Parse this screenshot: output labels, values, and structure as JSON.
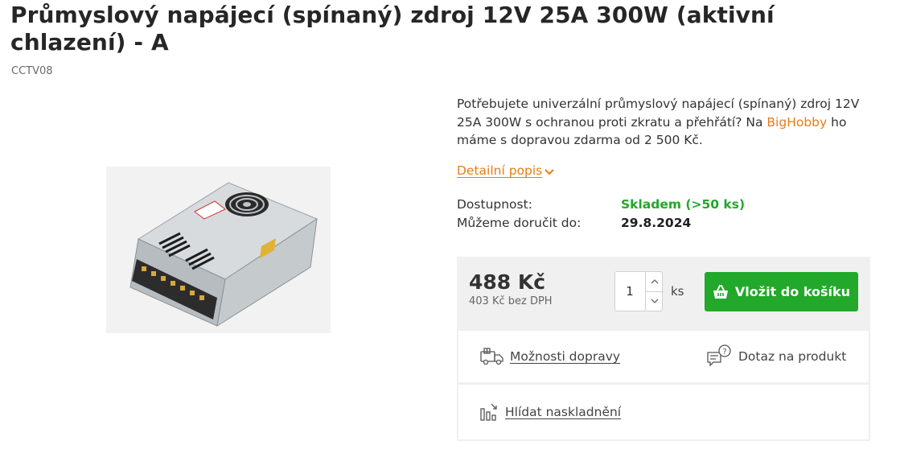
{
  "product": {
    "title": "Průmyslový napájecí (spínaný) zdroj 12V 25A 300W (aktivní chlazení) - A",
    "code": "CCTV08",
    "image_alt": "Průmyslový napájecí zdroj 12V 25A 300W",
    "description_before": "Potřebujete univerzální průmyslový napájecí (spínaný) zdroj 12V 25A 300W s ochranou proti zkratu a přehřátí? Na ",
    "description_link": "BigHobby",
    "description_after": " ho máme s dopravou zdarma od 2 500 Kč.",
    "detail_link": "Detailní popis"
  },
  "availability": {
    "label": "Dostupnost:",
    "value": "Skladem (>50 ks)",
    "delivery_label": "Můžeme doručit do:",
    "delivery_value": "29.8.2024"
  },
  "pricing": {
    "price": "488 Kč",
    "price_without_vat": "403 Kč bez DPH",
    "quantity": "1",
    "unit": "ks",
    "add_to_cart": "Vložit do košíku"
  },
  "actions": {
    "shipping": "Možnosti dopravy",
    "question": "Dotaz na produkt",
    "watch_stock": "Hlídat naskladnění"
  },
  "colors": {
    "accent_orange": "#e57e17",
    "stock_green": "#22a82b",
    "cart_button": "#22a82b"
  },
  "icons": {
    "chevron": "chevron-down-icon",
    "cart": "basket-icon",
    "shipping": "delivery-truck-icon",
    "question": "question-chat-icon",
    "watch": "stock-chart-icon"
  }
}
